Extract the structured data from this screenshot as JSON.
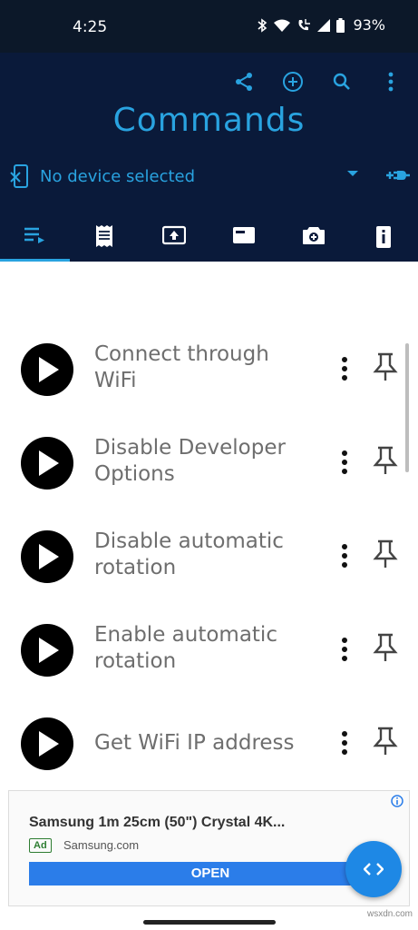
{
  "status_bar": {
    "time": "4:25",
    "battery": "93%"
  },
  "header": {
    "title": "Commands"
  },
  "device": {
    "label": "No device selected"
  },
  "commands": [
    {
      "line1": "Connect through",
      "line2": "WiFi"
    },
    {
      "line1": "Disable Developer",
      "line2": "Options"
    },
    {
      "line1": "Disable automatic",
      "line2": "rotation"
    },
    {
      "line1": "Enable automatic",
      "line2": "rotation"
    },
    {
      "line1": "Get WiFi IP address",
      "line2": ""
    }
  ],
  "ad": {
    "title": "Samsung 1m 25cm (50\") Crystal 4K...",
    "badge": "Ad",
    "domain": "Samsung.com",
    "button": "OPEN"
  },
  "watermark": "wsxdn.com",
  "colors": {
    "header_bg": "#0a1a3a",
    "accent": "#29a3e0",
    "fab": "#1e88e5"
  }
}
